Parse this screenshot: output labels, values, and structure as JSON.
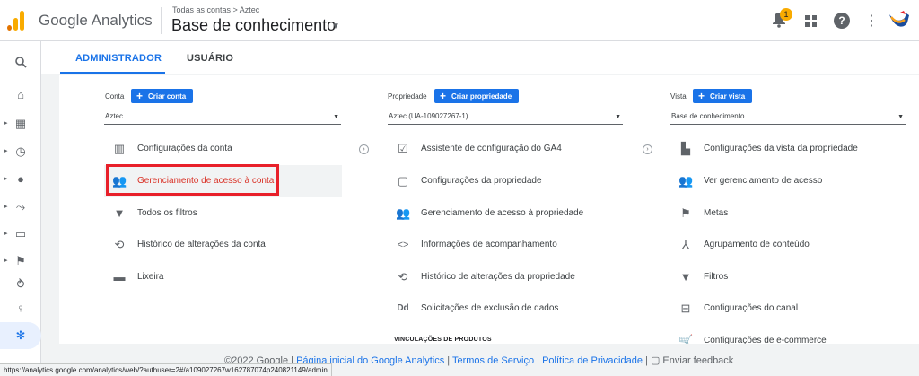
{
  "header": {
    "app_title": "Google Analytics",
    "breadcrumb": "Todas as contas > Aztec",
    "view_title": "Base de conhecimento",
    "notification_count": "1",
    "help_glyph": "?",
    "more_glyph": "⋮",
    "icons": [
      "analytics-logo",
      "bell-icon",
      "apps-grid-icon",
      "help-icon",
      "more-vert-icon",
      "account-avatar"
    ]
  },
  "rail": {
    "icons": [
      "search-icon",
      "home-icon",
      "dashboard-icon",
      "clock-icon",
      "person-icon",
      "acquisition-icon",
      "display-icon",
      "flag-icon",
      "path-icon",
      "lightbulb-icon",
      "gear-icon"
    ],
    "glyphs": [
      "🔍",
      "⌂",
      "▦",
      "◷",
      "●",
      "⤳",
      "▭",
      "⚑",
      "⥁",
      "♀",
      "✻"
    ]
  },
  "tabs": [
    {
      "label": "ADMINISTRADOR",
      "active": true
    },
    {
      "label": "USUÁRIO",
      "active": false
    }
  ],
  "columns": {
    "conta": {
      "label": "Conta",
      "create_label": "Criar conta",
      "selected": "Aztec",
      "items": [
        {
          "label": "Configurações da conta",
          "icon": "building-icon",
          "glyph": "▥"
        },
        {
          "label": "Gerenciamento de acesso à conta",
          "icon": "people-icon",
          "glyph": "👥"
        },
        {
          "label": "Todos os filtros",
          "icon": "filter-icon",
          "glyph": "▼"
        },
        {
          "label": "Histórico de alterações da conta",
          "icon": "history-icon",
          "glyph": "⟲"
        },
        {
          "label": "Lixeira",
          "icon": "trash-icon",
          "glyph": "▬"
        }
      ]
    },
    "propriedade": {
      "label": "Propriedade",
      "create_label": "Criar propriedade",
      "selected": "Aztec (UA-109027267-1)",
      "items": [
        {
          "label": "Assistente de configuração do GA4",
          "icon": "checkbox-icon",
          "glyph": "☑"
        },
        {
          "label": "Configurações da propriedade",
          "icon": "web-page-icon",
          "glyph": "▢"
        },
        {
          "label": "Gerenciamento de acesso à propriedade",
          "icon": "people-icon",
          "glyph": "👥"
        },
        {
          "label": "Informações de acompanhamento",
          "icon": "code-icon",
          "glyph": "<>"
        },
        {
          "label": "Histórico de alterações da propriedade",
          "icon": "history-icon",
          "glyph": "⟲"
        },
        {
          "label": "Solicitações de exclusão de dados",
          "icon": "data-deletion-icon",
          "glyph": "Dd"
        }
      ],
      "section_header": "VINCULAÇÕES DE PRODUTOS"
    },
    "vista": {
      "label": "Vista",
      "create_label": "Criar vista",
      "selected": "Base de conhecimento",
      "items": [
        {
          "label": "Configurações da vista da propriedade",
          "icon": "document-icon",
          "glyph": "▙"
        },
        {
          "label": "Ver gerenciamento de acesso",
          "icon": "people-icon",
          "glyph": "👥"
        },
        {
          "label": "Metas",
          "icon": "flag-icon",
          "glyph": "⚑"
        },
        {
          "label": "Agrupamento de conteúdo",
          "icon": "walking-person-icon",
          "glyph": "⅄"
        },
        {
          "label": "Filtros",
          "icon": "filter-icon",
          "glyph": "▼"
        },
        {
          "label": "Configurações do canal",
          "icon": "channel-icon",
          "glyph": "⊟"
        },
        {
          "label": "Configurações de e-commerce",
          "icon": "cart-icon",
          "glyph": "🛒"
        }
      ]
    }
  },
  "footer": {
    "copyright": "©2022 Google",
    "sep": "|",
    "links": [
      "Página inicial do Google Analytics",
      "Termos de Serviço",
      "Política de Privacidade"
    ],
    "feedback": "Enviar feedback",
    "feedback_glyph": "▢"
  },
  "status_url": "https://analytics.google.com/analytics/web/?authuser=2#/a109027267w162787074p240821149/admin",
  "colors": {
    "accent": "#1a73e8",
    "highlight_box": "#e8202a",
    "logo_orange": "#f9ab00"
  }
}
